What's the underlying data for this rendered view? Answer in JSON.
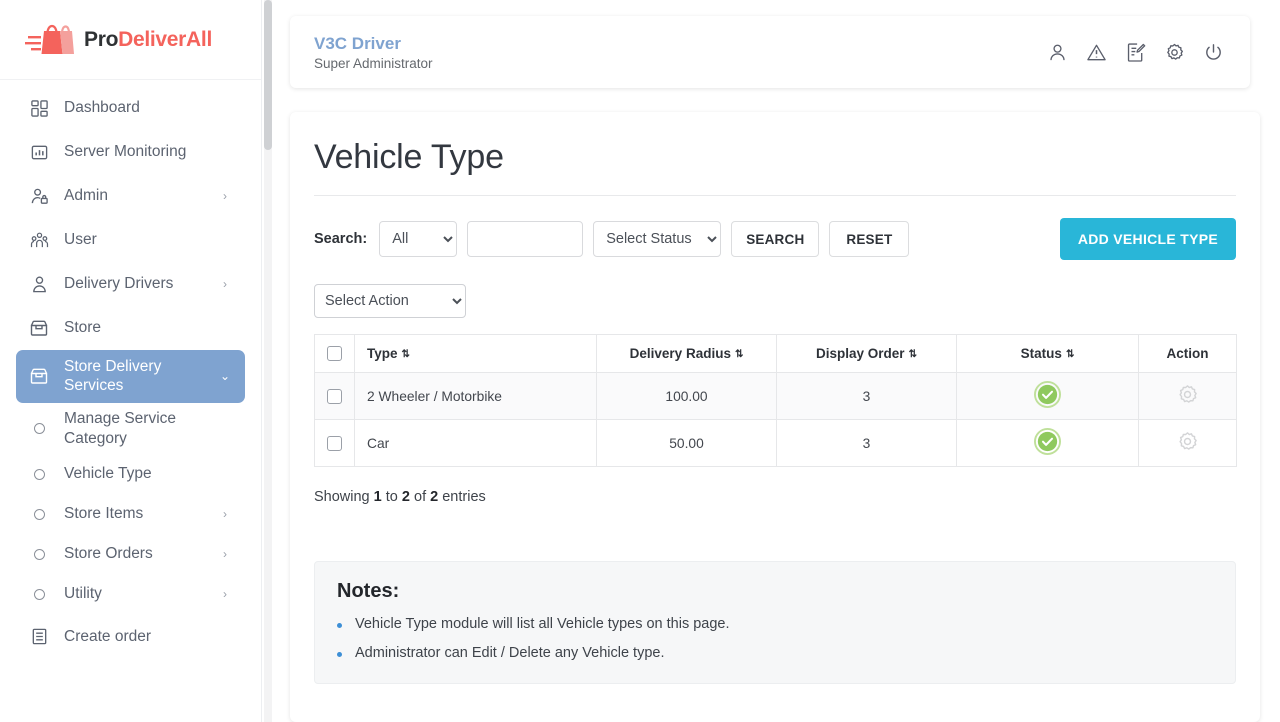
{
  "brand": {
    "part1": "Pro",
    "part2": "DeliverAll",
    "logo_icon": "shopping-bags-logo"
  },
  "sidebar": {
    "items": [
      {
        "label": "Dashboard",
        "icon": "dashboard-grid-icon",
        "caret": "",
        "state": ""
      },
      {
        "label": "Server Monitoring",
        "icon": "bar-chart-icon",
        "caret": "",
        "state": ""
      },
      {
        "label": "Admin",
        "icon": "admin-user-lock-icon",
        "caret": "›",
        "state": ""
      },
      {
        "label": "User",
        "icon": "users-group-icon",
        "caret": "",
        "state": ""
      },
      {
        "label": "Delivery Drivers",
        "icon": "driver-person-icon",
        "caret": "›",
        "state": ""
      },
      {
        "label": "Store",
        "icon": "store-icon",
        "caret": "",
        "state": ""
      },
      {
        "label": "Store Delivery Services",
        "icon": "store-icon",
        "caret": "⌄",
        "state": "active"
      }
    ],
    "subitems": [
      {
        "label": "Manage Service Category",
        "icon": "circle-bullet-icon",
        "caret": "",
        "state": ""
      },
      {
        "label": "Vehicle Type",
        "icon": "circle-bullet-icon",
        "caret": "",
        "state": "sel"
      },
      {
        "label": "Store Items",
        "icon": "circle-bullet-icon",
        "caret": "›",
        "state": ""
      },
      {
        "label": "Store Orders",
        "icon": "circle-bullet-icon",
        "caret": "›",
        "state": ""
      },
      {
        "label": "Utility",
        "icon": "circle-bullet-icon",
        "caret": "›",
        "state": ""
      }
    ],
    "create_order": {
      "label": "Create order",
      "icon": "document-list-icon"
    }
  },
  "topbar": {
    "app_name": "V3C Driver",
    "role": "Super Administrator",
    "actions": [
      {
        "name": "profile-icon"
      },
      {
        "name": "alert-triangle-icon"
      },
      {
        "name": "edit-document-icon"
      },
      {
        "name": "gear-icon"
      },
      {
        "name": "power-icon"
      }
    ]
  },
  "page": {
    "title": "Vehicle Type"
  },
  "search": {
    "label": "Search:",
    "field_select_value": "All",
    "field_options": [
      "All"
    ],
    "text_value": "",
    "text_placeholder": "",
    "status_select_value": "Select Status",
    "status_options": [
      "Select Status"
    ],
    "search_button": "SEARCH",
    "reset_button": "RESET",
    "add_button": "ADD VEHICLE TYPE",
    "accent_color": "#29b6d8"
  },
  "bulk": {
    "action_select_value": "Select Action",
    "action_options": [
      "Select Action"
    ]
  },
  "table": {
    "columns": [
      {
        "label": "",
        "sortable": false,
        "align": "center"
      },
      {
        "label": "Type",
        "sortable": true,
        "align": "left"
      },
      {
        "label": "Delivery Radius",
        "sortable": true,
        "align": "center"
      },
      {
        "label": "Display Order",
        "sortable": true,
        "align": "center"
      },
      {
        "label": "Status",
        "sortable": true,
        "align": "center"
      },
      {
        "label": "Action",
        "sortable": false,
        "align": "center"
      }
    ],
    "sort_glyph": "⇅",
    "rows": [
      {
        "type": "2 Wheeler / Motorbike",
        "delivery_radius": "100.00",
        "display_order": "3",
        "status_icon": "status-active-check-icon",
        "action_icon": "gear-icon"
      },
      {
        "type": "Car",
        "delivery_radius": "50.00",
        "display_order": "3",
        "status_icon": "status-active-check-icon",
        "action_icon": "gear-icon"
      }
    ],
    "status_color": "#7ac143"
  },
  "footer": {
    "showing_prefix": "Showing",
    "from": "1",
    "to_word": "to",
    "to": "2",
    "of_word": "of",
    "total": "2",
    "entries_word": "entries"
  },
  "notes": {
    "title": "Notes:",
    "items": [
      "Vehicle Type module will list all Vehicle types on this page.",
      "Administrator can Edit / Delete any Vehicle type."
    ],
    "bullet_color": "#3d8fd6"
  }
}
